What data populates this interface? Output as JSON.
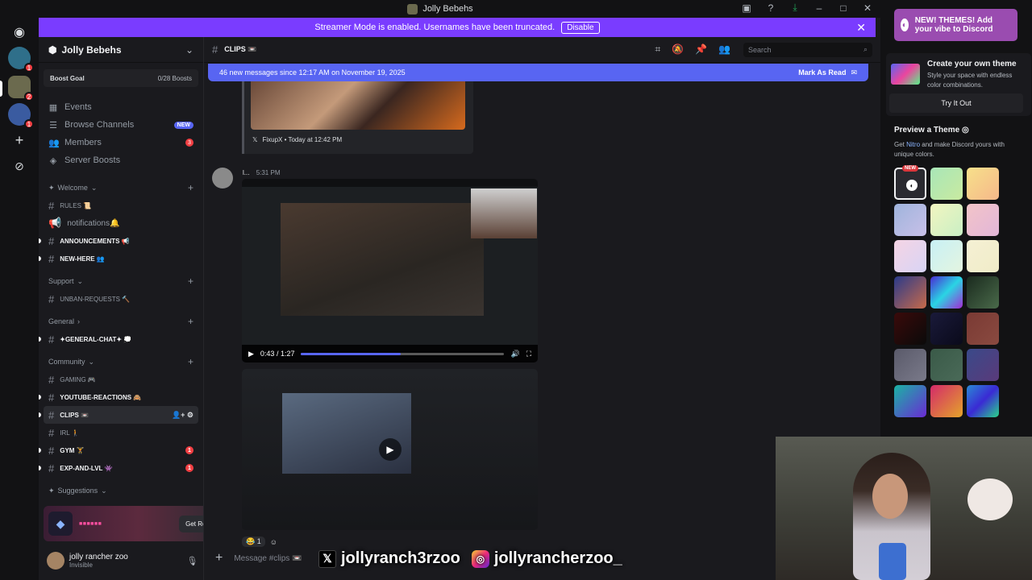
{
  "window": {
    "title": "Jolly Bebehs"
  },
  "banner": {
    "text": "Streamer Mode is enabled. Usernames have been truncated.",
    "button": "Disable"
  },
  "rail": {
    "badges": [
      "1",
      "2",
      "1"
    ]
  },
  "guild": {
    "name": "Jolly Bebehs",
    "boost_goal_label": "Boost Goal",
    "boost_goal_value": "0/28 Boosts",
    "nav": [
      {
        "label": "Events"
      },
      {
        "label": "Browse Channels",
        "tag": "NEW"
      },
      {
        "label": "Members",
        "count": "3"
      },
      {
        "label": "Server Boosts"
      }
    ],
    "categories": {
      "welcome": "Welcome",
      "support": "Support",
      "general": "General",
      "community": "Community",
      "suggestions": "Suggestions"
    },
    "channels": {
      "rules": "RULES 📜",
      "notifications": "notifications🔔",
      "announcements": "ANNOUNCEMENTS 📢",
      "new_here": "NEW-HERE 👥",
      "unban": "UNBAN-REQUESTS 🔨",
      "general_chat": "✦GENERAL-CHAT✦ 💭",
      "gaming": "GAMING 🎮",
      "youtube": "YOUTUBE-REACTIONS 🙈",
      "clips": "CLIPS 📼",
      "irl": "IRL 🚶",
      "gym": "GYM 🏋",
      "exp": "EXP-AND-LVL 👾",
      "gym_count": "1",
      "exp_count": "1"
    }
  },
  "reward": {
    "button": "Get Reward!"
  },
  "user": {
    "name": "jolly rancher zoo",
    "status": "Invisible"
  },
  "chat": {
    "channel": "CLIPS 📼",
    "search_placeholder": "Search",
    "new_messages": "46 new messages since 12:17 AM on November 19, 2025",
    "mark_read": "Mark As Read",
    "embed_footer": "FixupX • Today at 12:42 PM",
    "message_author": "l...",
    "message_time": "5:31 PM",
    "video_time": "0:43 / 1:27",
    "video_progress": 0.49,
    "reaction_count": "1",
    "composer_placeholder": "Message #clips 📼"
  },
  "social": {
    "x_handle": "jollyranch3rzoo",
    "ig_handle": "jollyrancherzoo_"
  },
  "themes": {
    "promo": "NEW! THEMES! Add your vibe to Discord",
    "create_title": "Create your own theme",
    "create_desc": "Style your space with endless color combinations.",
    "try_button": "Try It Out",
    "preview_title": "Preview a Theme",
    "preview_desc_pre": "Get ",
    "preview_nitro": "Nitro",
    "preview_desc_post": " and make Discord yours with unique colors.",
    "new_tag": "NEW",
    "swatches": [
      "#2a2a30",
      "linear-gradient(135deg,#a8e6b8,#c9eaa0)",
      "linear-gradient(135deg,#f7e08a,#f5b88a)",
      "linear-gradient(135deg,#9fb4dc,#c8c0e8)",
      "linear-gradient(135deg,#f2f5c0,#c9efc4)",
      "linear-gradient(135deg,#f3c4c8,#e2b6d8)",
      "linear-gradient(135deg,#f5d4e4,#d8d4f5)",
      "linear-gradient(135deg,#c8f0f5,#e4f5e0)",
      "linear-gradient(135deg,#f5f0d4,#f0ecc8)",
      "linear-gradient(135deg,#2a3a8a,#c86a4a)",
      "linear-gradient(135deg,#4a2ad4,#2ad4e4,#a42ad4)",
      "linear-gradient(135deg,#1a2a1e,#4a6a4a)",
      "linear-gradient(135deg,#3a0a0a,#0a0a0a)",
      "linear-gradient(135deg,#1a1a3a,#0a0a1a)",
      "linear-gradient(135deg,#7a3a34,#8a4a40)",
      "linear-gradient(135deg,#5a5a6a,#7a7a8a)",
      "linear-gradient(135deg,#3a5a48,#4a6a58)",
      "linear-gradient(135deg,#3a4a8a,#5a3a7a)",
      "linear-gradient(135deg,#1ab4a4,#6a2ad4)",
      "linear-gradient(135deg,#d42a6a,#e4a42a)",
      "linear-gradient(135deg,#2a8ad4,#3a2ad4,#2ad48a)"
    ]
  }
}
